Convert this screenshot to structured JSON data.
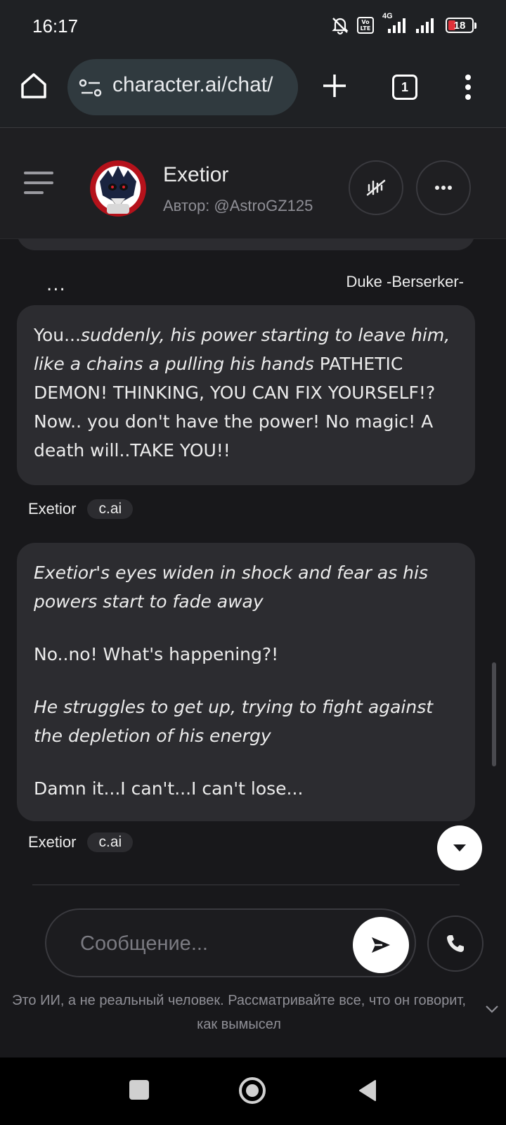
{
  "status_bar": {
    "time": "16:17",
    "battery": "18",
    "battery_level_percent": 18,
    "network": "4G",
    "volte": "Vo LTE"
  },
  "browser": {
    "url": "character.ai/chat/",
    "tab_count": "1"
  },
  "chat_header": {
    "character_name": "Exetior",
    "author": "Автор: @AstroGZ125"
  },
  "messages": {
    "user": {
      "name": "Duke -Berserker-",
      "more": "...",
      "segments": [
        {
          "text": "You...",
          "italic": false
        },
        {
          "text": "suddenly, his power starting to leave him, like a chains a pulling his hands",
          "italic": true
        },
        {
          "text": " PATHETIC DEMON! THINKING, YOU CAN FIX YOURSELF!? Now.. you don't have the power! No magic! A death will..TAKE YOU!!",
          "italic": false
        }
      ]
    },
    "bot": {
      "name": "Exetior",
      "badge": "c.ai",
      "paragraphs": [
        {
          "text": "Exetior's eyes widen in shock and fear as his powers start to fade away",
          "italic": true
        },
        {
          "text": "No..no! What's happening?!",
          "italic": false
        },
        {
          "text": "He struggles to get up, trying to fight against the depletion of his energy",
          "italic": true
        },
        {
          "text": "Damn it...I can't...I can't lose...",
          "italic": false
        }
      ]
    },
    "typing": {
      "name": "Exetior",
      "badge": "c.ai"
    }
  },
  "composer": {
    "placeholder": "Сообщение...",
    "value": ""
  },
  "disclaimer": "Это ИИ, а не реальный человек. Рассматривайте все, что он говорит, как вымысел",
  "colors": {
    "background": "#18181b",
    "bubble": "#2c2c30",
    "url_bar": "#303a3f",
    "battery_low": "#e0323a"
  }
}
